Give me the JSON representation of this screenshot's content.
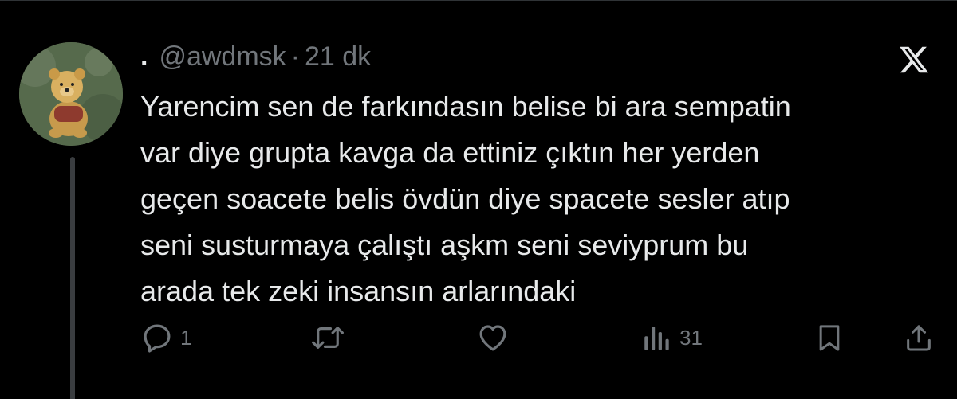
{
  "tweet": {
    "display_name": ".",
    "handle": "@awdmsk",
    "separator": "·",
    "time": "21 dk",
    "text": "Yarencim sen de farkındasın belise bi ara sempatin\nvar diye grupta kavga da ettiniz çıktın her yerden\ngeçen soacete belis övdün diye spacete sesler atıp\nseni susturmaya çalıştı aşkm seni seviyprum bu\narada tek zeki insansın arlarındaki",
    "avatar_icon": "winnie-the-pooh-avatar"
  },
  "actions": {
    "reply_count": "1",
    "retweet_count": "",
    "like_count": "",
    "views_count": "31"
  },
  "colors": {
    "background": "#000000",
    "text": "#e7e9ea",
    "secondary": "#71767b",
    "thread_line": "#3a3d40"
  }
}
